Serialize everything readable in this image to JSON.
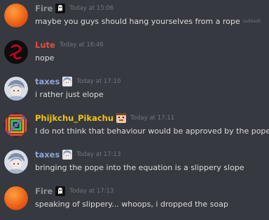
{
  "messages": [
    {
      "author": "Fire",
      "author_color": "#8e9297",
      "badge_icon": "ghost-icon",
      "avatar_icon": "orange-circle-avatar-icon",
      "timestamp": "Today at 15:06",
      "content": "maybe you guys should hang yourselves from a rope",
      "edited_label": "(edited)"
    },
    {
      "author": "Lute",
      "author_color": "#e74c3c",
      "avatar_icon": "red-symbol-avatar-icon",
      "timestamp": "Today at 16:46",
      "content": "nope"
    },
    {
      "author": "taxes",
      "author_color": "#8fa4d8",
      "badge_icon": "anime-face-icon",
      "avatar_icon": "anime-character-avatar-icon",
      "timestamp": "Today at 17:10",
      "content": "i rather just elope"
    },
    {
      "author": "Phijkchu_Pikachu",
      "author_color": "#f1c40f",
      "badge_icon": "pixel-face-icon",
      "avatar_icon": "rainbow-pixel-avatar-icon",
      "timestamp": "Today at 17:11",
      "content": "I do not think that behaviour would be approved by the pope"
    },
    {
      "author": "taxes",
      "author_color": "#8fa4d8",
      "badge_icon": "anime-face-icon",
      "avatar_icon": "anime-character-avatar-icon",
      "timestamp": "Today at 17:13",
      "content": "bringing the pope into the equation is a slippery slope"
    },
    {
      "author": "Fire",
      "author_color": "#8e9297",
      "badge_icon": "ghost-icon",
      "avatar_icon": "orange-circle-avatar-icon",
      "timestamp": "Today at 17:13",
      "content": "speaking of slippery... whoops, i dropped the soap"
    }
  ]
}
